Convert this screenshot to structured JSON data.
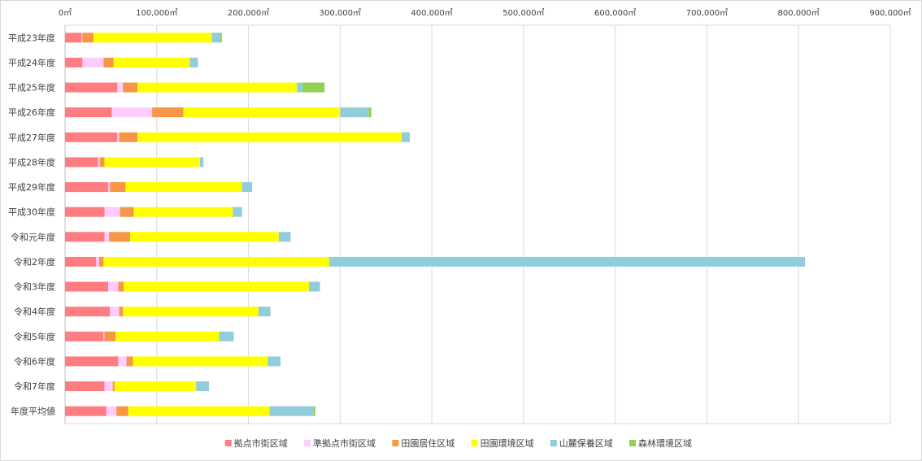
{
  "chart_data": {
    "type": "bar",
    "orientation": "horizontal",
    "stacked": true,
    "title": "",
    "xlabel": "",
    "ylabel": "",
    "xlim": [
      0,
      900000
    ],
    "x_ticks": [
      "0㎡",
      "100,000㎡",
      "200,000㎡",
      "300,000㎡",
      "400,000㎡",
      "500,000㎡",
      "600,000㎡",
      "700,000㎡",
      "800,000㎡",
      "900,000㎡"
    ],
    "x_tick_values": [
      0,
      100000,
      200000,
      300000,
      400000,
      500000,
      600000,
      700000,
      800000,
      900000
    ],
    "grid": true,
    "legend_position": "bottom",
    "categories": [
      "平成23年度",
      "平成24年度",
      "平成25年度",
      "平成26年度",
      "平成27年度",
      "平成28年度",
      "平成29年度",
      "平成30年度",
      "令和元年度",
      "令和2年度",
      "令和3年度",
      "令和4年度",
      "令和5年度",
      "令和6年度",
      "令和7年度",
      "年度平均値"
    ],
    "series": [
      {
        "name": "拠点市街区域",
        "color": "#ff7c80",
        "values": [
          18000,
          19000,
          57000,
          51000,
          57000,
          36000,
          47000,
          43000,
          43000,
          34000,
          47000,
          49000,
          42000,
          58000,
          43000,
          45000
        ]
      },
      {
        "name": "準拠点市街区域",
        "color": "#ffccff",
        "values": [
          1000,
          23000,
          6000,
          44000,
          2000,
          2000,
          2000,
          17000,
          5000,
          3000,
          11000,
          10000,
          1000,
          9000,
          9000,
          11000
        ]
      },
      {
        "name": "田園居住区域",
        "color": "#f79646",
        "values": [
          12000,
          11000,
          16000,
          34000,
          20000,
          5000,
          17000,
          15000,
          23000,
          5000,
          6000,
          4000,
          12000,
          7000,
          2000,
          13000
        ]
      },
      {
        "name": "田園環境区域",
        "color": "#ffff00",
        "values": [
          129000,
          83000,
          174000,
          171000,
          288000,
          104000,
          127000,
          108000,
          162000,
          246000,
          202000,
          148000,
          113000,
          147000,
          89000,
          154000
        ]
      },
      {
        "name": "山麓保養区域",
        "color": "#92cddc",
        "values": [
          9000,
          9000,
          6000,
          31000,
          9000,
          4000,
          11000,
          10000,
          13000,
          519000,
          12000,
          13000,
          16000,
          14000,
          14000,
          48000
        ]
      },
      {
        "name": "森林環境区域",
        "color": "#92d050",
        "values": [
          2000,
          0,
          24000,
          3000,
          0,
          0,
          0,
          0,
          0,
          0,
          0,
          0,
          0,
          0,
          0,
          2000
        ]
      }
    ]
  }
}
